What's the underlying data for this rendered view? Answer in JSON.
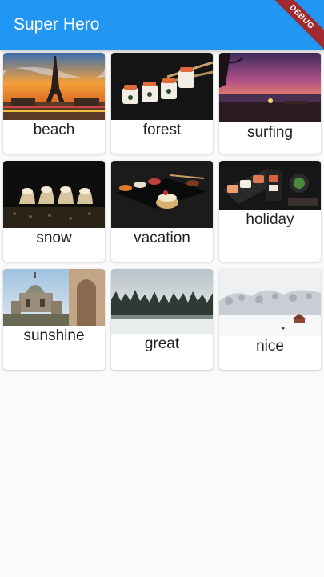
{
  "appbar": {
    "title": "Super Hero"
  },
  "debug_banner": {
    "text": "DEBUG"
  },
  "colors": {
    "primary": "#2196f3",
    "banner": "#a0282e",
    "background": "#fafafa"
  },
  "cards": [
    {
      "label": "beach",
      "image": "eiffel-tower-sunset-image"
    },
    {
      "label": "forest",
      "image": "sushi-rolls-image"
    },
    {
      "label": "surfing",
      "image": "beach-dusk-image"
    },
    {
      "label": "snow",
      "image": "cream-pastries-image"
    },
    {
      "label": "vacation",
      "image": "food-platter-image"
    },
    {
      "label": "holiday",
      "image": "sushi-board-image"
    },
    {
      "label": "sunshine",
      "image": "domed-monument-image"
    },
    {
      "label": "great",
      "image": "misty-pine-forest-image"
    },
    {
      "label": "nice",
      "image": "snowy-landscape-image"
    }
  ]
}
